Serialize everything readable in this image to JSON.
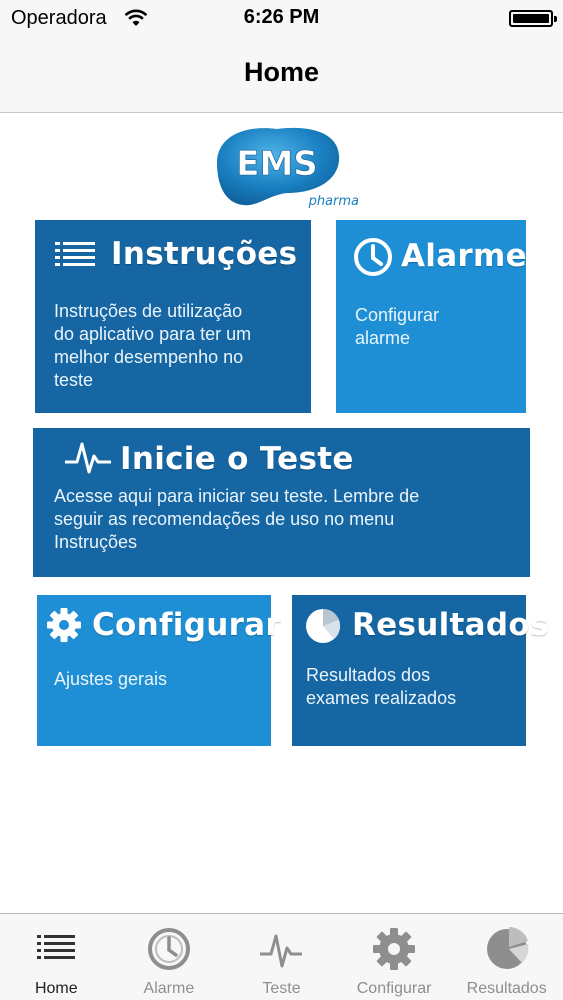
{
  "status_bar": {
    "carrier": "Operadora",
    "time": "6:26 PM"
  },
  "nav": {
    "title": "Home"
  },
  "logo": {
    "brand": "EMS",
    "sub": "pharma"
  },
  "tiles": {
    "instrucoes": {
      "title": "Instruções",
      "description_lines": [
        "Instruções de utilização",
        "do aplicativo para ter um",
        "melhor desempenho no",
        "teste"
      ],
      "icon": "list-icon"
    },
    "alarme": {
      "title": "Alarme",
      "description_lines": [
        "Configurar",
        "alarme"
      ],
      "icon": "clock-icon"
    },
    "teste": {
      "title": "Inicie o Teste",
      "description_lines": [
        "Acesse aqui para iniciar seu teste. Lembre de",
        "seguir as recomendações de uso no menu",
        "Instruções"
      ],
      "icon": "heartbeat-icon"
    },
    "configurar": {
      "title": "Configurar",
      "description_lines": [
        "Ajustes gerais"
      ],
      "icon": "gear-icon"
    },
    "resultados": {
      "title": "Resultados",
      "description_lines": [
        "Resultados dos",
        "exames realizados"
      ],
      "icon": "pie-chart-icon"
    }
  },
  "colors": {
    "tile_dark": "#1566a3",
    "tile_light": "#1e8fd4",
    "logo_blue": "#1a7fc1"
  },
  "tabbar": {
    "items": [
      {
        "label": "Home",
        "icon": "list-icon",
        "active": true
      },
      {
        "label": "Alarme",
        "icon": "clock-icon",
        "active": false
      },
      {
        "label": "Teste",
        "icon": "heartbeat-icon",
        "active": false
      },
      {
        "label": "Configurar",
        "icon": "gear-icon",
        "active": false
      },
      {
        "label": "Resultados",
        "icon": "pie-chart-icon",
        "active": false
      }
    ]
  }
}
